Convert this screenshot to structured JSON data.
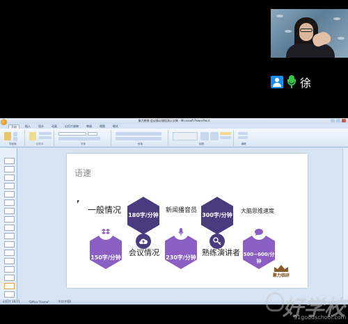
{
  "participant": {
    "name": "徐",
    "user_icon": "user-icon",
    "mic_icon": "microphone-icon",
    "mic_color": "#39c14a"
  },
  "app": {
    "window_title": "聚力教育:会议情况课程演示文稿 - Microsoft PowerPoint",
    "tabs": [
      "开始",
      "插入",
      "设计",
      "动画",
      "幻灯片放映",
      "审阅",
      "视图",
      "格式"
    ],
    "active_tab_index": 0,
    "ribbon_groups": [
      "剪贴板",
      "幻灯片",
      "字体",
      "段落",
      "绘图",
      "编辑"
    ],
    "status": {
      "slide": "幻灯片 16/71",
      "theme": "\"Office Theme\"",
      "language": "中文(中国)"
    }
  },
  "slide": {
    "title": "语速",
    "labels": {
      "general": "一般情况",
      "news": "新闻播音员",
      "brain": "大脑思维速度",
      "meeting": "会议情况",
      "lecturer": "熟练演讲者"
    },
    "rates": {
      "r150": "150字/分钟",
      "r180": "180字/分钟",
      "r230": "230字/分钟",
      "r300": "300字/分钟",
      "r500_600": "500~600/分钟"
    },
    "icons": [
      "dropbox-icon",
      "cloud-upload-icon",
      "microphone-icon",
      "key-icon",
      "chat-icon"
    ],
    "logo_text": "聚力临研",
    "colors": {
      "dark_purple": "#4a3b7e",
      "light_purple": "#8a5ec3"
    }
  },
  "watermark": {
    "text": "好学校",
    "url": "91goodschool.com"
  }
}
